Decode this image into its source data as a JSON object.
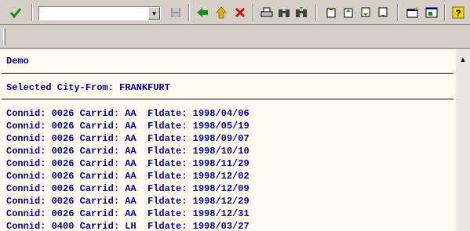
{
  "toolbar": {
    "enter_icon": "check-icon",
    "command_field_value": "",
    "icons": {
      "save": "save-icon",
      "back": "back-arrow-icon",
      "exit": "exit-icon",
      "cancel": "cancel-icon",
      "print": "print-icon",
      "find": "find-icon",
      "find_next": "find-next-icon",
      "first_page": "first-page-icon",
      "prev_page": "previous-page-icon",
      "next_page": "next-page-icon",
      "last_page": "last-page-icon",
      "new_session": "new-session-icon",
      "shortcut": "shortcut-icon",
      "help": "help-icon"
    }
  },
  "list": {
    "title": "Demo",
    "subtitle": "Selected City-From: FRANKFURT",
    "rows": [
      "Connid: 0026 Carrid: AA  Fldate: 1998/04/06",
      "Connid: 0026 Carrid: AA  Fldate: 1998/05/19",
      "Connid: 0026 Carrid: AA  Fldate: 1998/09/07",
      "Connid: 0026 Carrid: AA  Fldate: 1998/10/10",
      "Connid: 0026 Carrid: AA  Fldate: 1998/11/29",
      "Connid: 0026 Carrid: AA  Fldate: 1998/12/02",
      "Connid: 0026 Carrid: AA  Fldate: 1998/12/09",
      "Connid: 0026 Carrid: AA  Fldate: 1998/12/29",
      "Connid: 0026 Carrid: AA  Fldate: 1998/12/31",
      "Connid: 0400 Carrid: LH  Fldate: 1998/03/27"
    ]
  }
}
